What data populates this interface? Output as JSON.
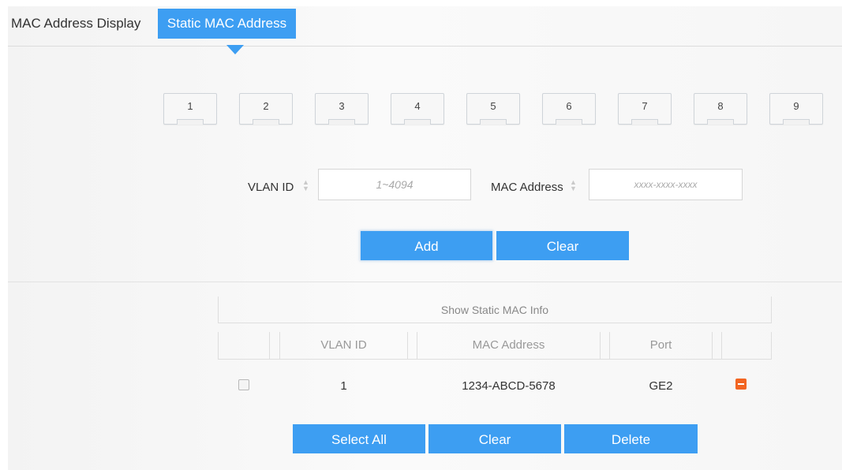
{
  "tabs": {
    "display_label": "MAC Address Display",
    "static_label": "Static MAC Address"
  },
  "ports": [
    "1",
    "2",
    "3",
    "4",
    "5",
    "6",
    "7",
    "8",
    "9"
  ],
  "form": {
    "vlan_label": "VLAN ID",
    "vlan_placeholder": "1~4094",
    "mac_label": "MAC Address",
    "mac_placeholder": "xxxx-xxxx-xxxx",
    "add_label": "Add",
    "clear_label": "Clear"
  },
  "table": {
    "title": "Show Static MAC Info",
    "headers": {
      "vlan": "VLAN ID",
      "mac": "MAC Address",
      "port": "Port"
    },
    "rows": [
      {
        "vlan": "1",
        "mac": "1234-ABCD-5678",
        "port": "GE2"
      }
    ]
  },
  "actions": {
    "select_all": "Select All",
    "clear": "Clear",
    "delete": "Delete"
  },
  "colors": {
    "accent": "#3d9ef2",
    "delete_icon": "#f26522"
  }
}
